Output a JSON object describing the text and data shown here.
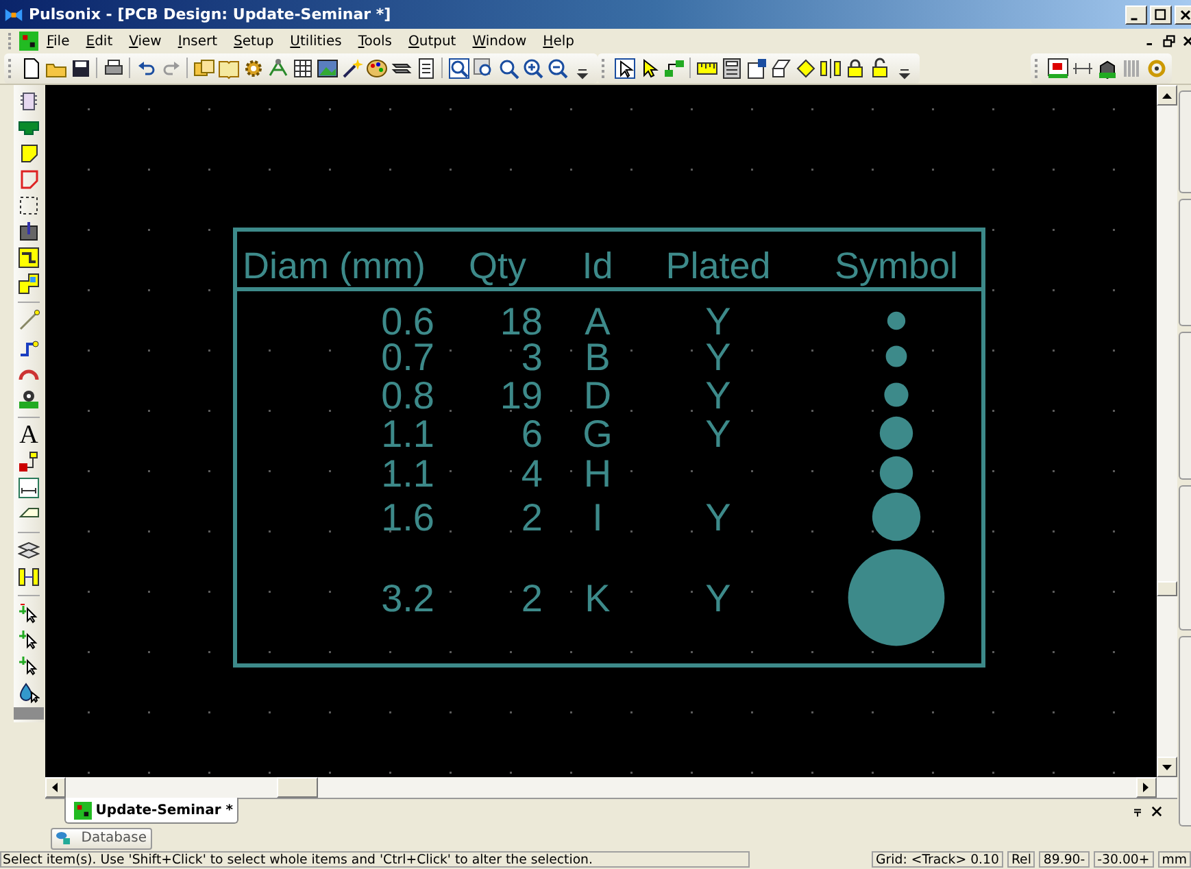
{
  "window": {
    "title": "Pulsonix - [PCB Design: Update-Seminar *]"
  },
  "menu": [
    {
      "label": "File"
    },
    {
      "label": "Edit"
    },
    {
      "label": "View"
    },
    {
      "label": "Insert"
    },
    {
      "label": "Setup"
    },
    {
      "label": "Utilities"
    },
    {
      "label": "Tools"
    },
    {
      "label": "Output"
    },
    {
      "label": "Window"
    },
    {
      "label": "Help"
    }
  ],
  "left_toolbar": {
    "text_tool_glyph": "A"
  },
  "drill_table": {
    "columns": [
      "Diam (mm)",
      "Qty",
      "Id",
      "Plated",
      "Symbol"
    ],
    "rows": [
      {
        "diam": "0.6",
        "qty": "18",
        "id": "A",
        "plated": "Y"
      },
      {
        "diam": "0.7",
        "qty": "3",
        "id": "B",
        "plated": "Y"
      },
      {
        "diam": "0.8",
        "qty": "19",
        "id": "D",
        "plated": "Y"
      },
      {
        "diam": "1.1",
        "qty": "6",
        "id": "G",
        "plated": "Y"
      },
      {
        "diam": "1.1",
        "qty": "4",
        "id": "H"
      },
      {
        "diam": "1.6",
        "qty": "2",
        "id": "I",
        "plated": "Y"
      },
      {
        "diam": "3.2",
        "qty": "2",
        "id": "K",
        "plated": "Y"
      }
    ]
  },
  "document_tabs": [
    {
      "label": "Update-Seminar *",
      "selected": true
    }
  ],
  "panel_buttons": [
    {
      "label": "Database"
    }
  ],
  "status_bar": {
    "message": "Select item(s). Use 'Shift+Click' to select whole items and 'Ctrl+Click' to alter the selection.",
    "fields": [
      "Grid: <Track> 0.10",
      "Rel",
      "89.90-",
      "-30.00+",
      "mm"
    ]
  }
}
